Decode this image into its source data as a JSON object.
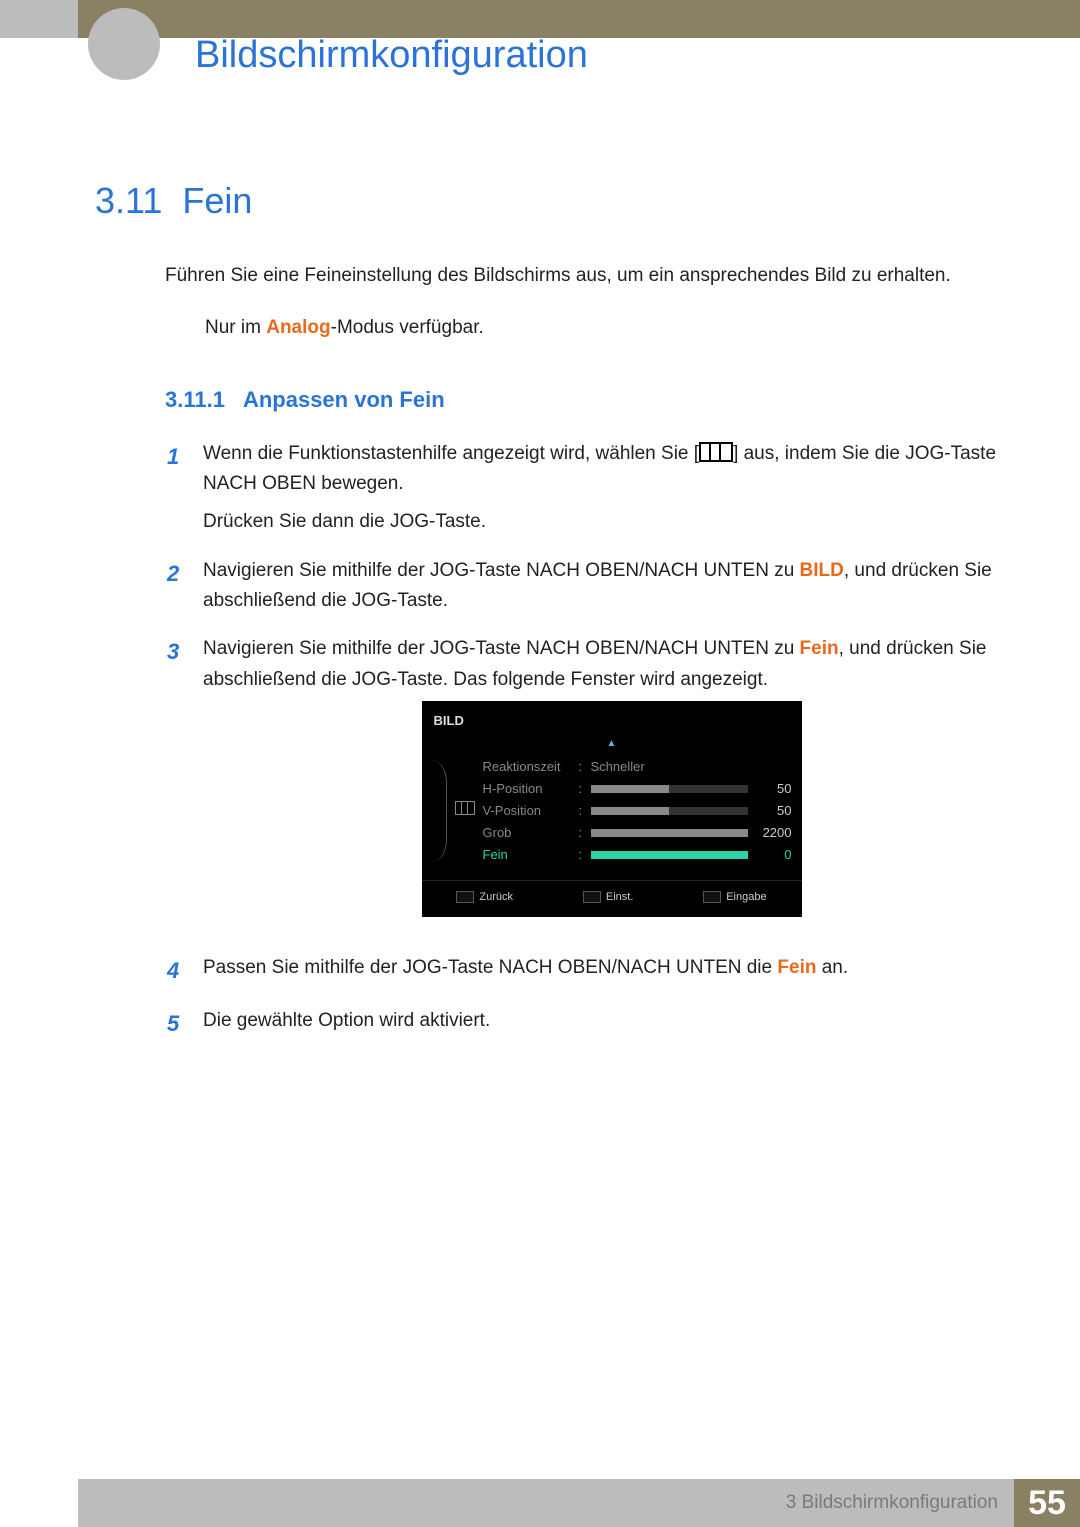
{
  "chapter_title": "Bildschirmkonfiguration",
  "section": {
    "number": "3.11",
    "title": "Fein"
  },
  "intro": "Führen Sie eine Feineinstellung des Bildschirms aus, um ein ansprechendes Bild zu erhalten.",
  "note": {
    "prefix": "Nur im ",
    "mode": "Analog",
    "suffix": "-Modus verfügbar."
  },
  "subsection": {
    "number": "3.11.1",
    "title": "Anpassen von Fein"
  },
  "steps": [
    {
      "n": "1",
      "parts": [
        {
          "t": "Wenn die Funktionstastenhilfe angezeigt wird, wählen Sie ["
        },
        {
          "icon": "menu"
        },
        {
          "t": "] aus, indem Sie die JOG-Taste NACH OBEN bewegen."
        }
      ],
      "extra": "Drücken Sie dann die JOG-Taste."
    },
    {
      "n": "2",
      "parts": [
        {
          "t": "Navigieren Sie mithilfe der JOG-Taste NACH OBEN/NACH UNTEN zu "
        },
        {
          "em": "BILD"
        },
        {
          "t": ", und drücken Sie abschließend die JOG-Taste."
        }
      ]
    },
    {
      "n": "3",
      "parts": [
        {
          "t": "Navigieren Sie mithilfe der JOG-Taste NACH OBEN/NACH UNTEN zu "
        },
        {
          "em": "Fein"
        },
        {
          "t": ", und drücken Sie abschließend die JOG-Taste. Das folgende Fenster wird angezeigt."
        }
      ]
    },
    {
      "n": "4",
      "parts": [
        {
          "t": "Passen Sie mithilfe der JOG-Taste NACH OBEN/NACH UNTEN die "
        },
        {
          "em": "Fein"
        },
        {
          "t": " an."
        }
      ]
    },
    {
      "n": "5",
      "parts": [
        {
          "t": "Die gewählte Option wird aktiviert."
        }
      ]
    }
  ],
  "osd": {
    "title": "BILD",
    "rows": [
      {
        "label": "Reaktionszeit",
        "value_text": "Schneller"
      },
      {
        "label": "H-Position",
        "value": 50,
        "max": 100
      },
      {
        "label": "V-Position",
        "value": 50,
        "max": 100
      },
      {
        "label": "Grob",
        "value": 2200,
        "max": 2200
      },
      {
        "label": "Fein",
        "value": 0,
        "max": 100,
        "active": true
      }
    ],
    "footer": {
      "back": "Zurück",
      "adjust": "Einst.",
      "enter": "Eingabe"
    }
  },
  "footer": {
    "chapter_ref": "3 Bildschirmkonfiguration",
    "page": "55"
  }
}
